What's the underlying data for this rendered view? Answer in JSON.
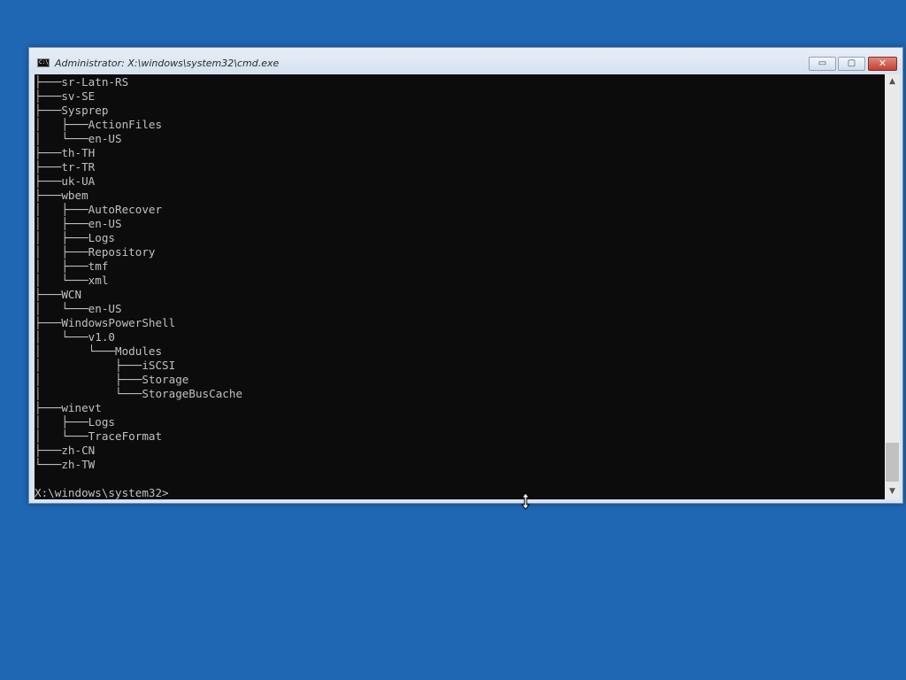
{
  "window": {
    "title": "Administrator: X:\\windows\\system32\\cmd.exe",
    "icon": "cmd-icon",
    "icon_label": "C:\\",
    "controls": {
      "minimize": "▭",
      "maximize": "▢",
      "close": "✕"
    }
  },
  "console": {
    "lines": [
      "├───sr-Latn-RS",
      "├───sv-SE",
      "├───Sysprep",
      "│   ├───ActionFiles",
      "│   └───en-US",
      "├───th-TH",
      "├───tr-TR",
      "├───uk-UA",
      "├───wbem",
      "│   ├───AutoRecover",
      "│   ├───en-US",
      "│   ├───Logs",
      "│   ├───Repository",
      "│   ├───tmf",
      "│   └───xml",
      "├───WCN",
      "│   └───en-US",
      "├───WindowsPowerShell",
      "│   └───v1.0",
      "│       └───Modules",
      "│           ├───iSCSI",
      "│           ├───Storage",
      "│           └───StorageBusCache",
      "├───winevt",
      "│   ├───Logs",
      "│   └───TraceFormat",
      "├───zh-CN",
      "└───zh-TW",
      "",
      "X:\\windows\\system32>"
    ]
  },
  "scrollbar": {
    "up_arrow": "▲",
    "down_arrow": "▼"
  },
  "colors": {
    "desktop": "#1f66b3",
    "console_bg": "#0c0c0c",
    "console_text": "#c0c0c0"
  }
}
